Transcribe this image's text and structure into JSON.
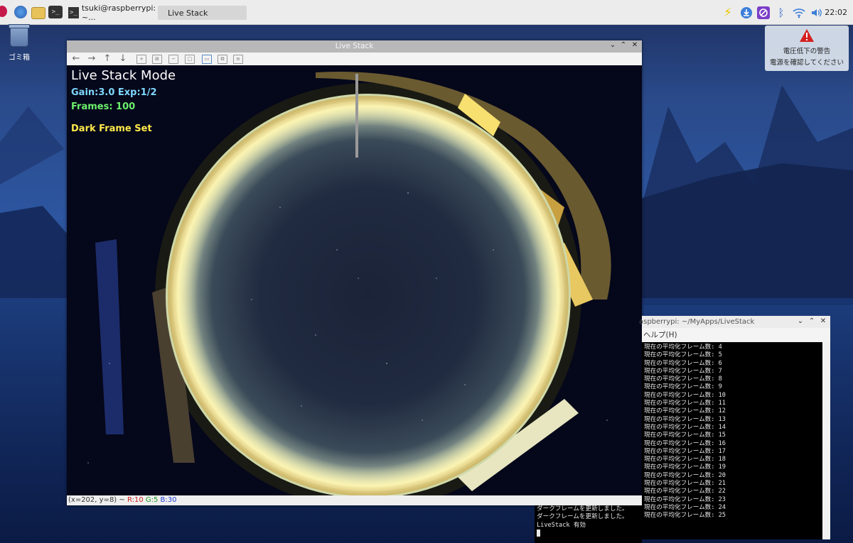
{
  "taskbar": {
    "terminal_task_label": "tsuki@raspberrypi: ~...",
    "livestack_task_label": "Live Stack",
    "clock": "22:02"
  },
  "desktop": {
    "trash_label": "ゴミ箱"
  },
  "warning": {
    "line1": "電圧低下の警告",
    "line2": "電源を確認してください"
  },
  "livestack_window": {
    "title": "Live Stack",
    "overlay": {
      "mode": "Live Stack Mode",
      "gain_exp": "Gain:3.0 Exp:1/2",
      "frames": "Frames: 100",
      "dark": "Dark Frame Set"
    },
    "status": {
      "coords": "(x=202, y=8) ~ ",
      "r": "R:10",
      "g": "G:5",
      "b": "B:30"
    }
  },
  "terminal_window": {
    "title": "aspberrypi: ~/MyApps/LiveStack",
    "menu_help": "ヘルプ(H)",
    "lines": [
      "現在の平均化フレーム数: 4",
      "現在の平均化フレーム数: 5",
      "現在の平均化フレーム数: 6",
      "現在の平均化フレーム数: 7",
      "現在の平均化フレーム数: 8",
      "現在の平均化フレーム数: 9",
      "現在の平均化フレーム数: 10",
      "現在の平均化フレーム数: 11",
      "現在の平均化フレーム数: 12",
      "現在の平均化フレーム数: 13",
      "現在の平均化フレーム数: 14",
      "現在の平均化フレーム数: 15",
      "現在の平均化フレーム数: 16",
      "現在の平均化フレーム数: 17",
      "現在の平均化フレーム数: 18",
      "現在の平均化フレーム数: 19",
      "現在の平均化フレーム数: 20",
      "現在の平均化フレーム数: 21",
      "現在の平均化フレーム数: 22",
      "現在の平均化フレーム数: 23",
      "現在の平均化フレーム数: 24",
      "現在の平均化フレーム数: 25"
    ],
    "lower_lines": [
      "ダークフレームを更新しました。",
      "ダークフレームを更新しました。",
      "LiveStack 有効"
    ]
  },
  "colors": {
    "overlay_white": "#ffffff",
    "overlay_cyan": "#7fd8ff",
    "overlay_green": "#6cf06c",
    "overlay_yellow": "#ffe94a",
    "status_r": "#d02020",
    "status_g": "#1a9a1a",
    "status_b": "#2040d0"
  }
}
